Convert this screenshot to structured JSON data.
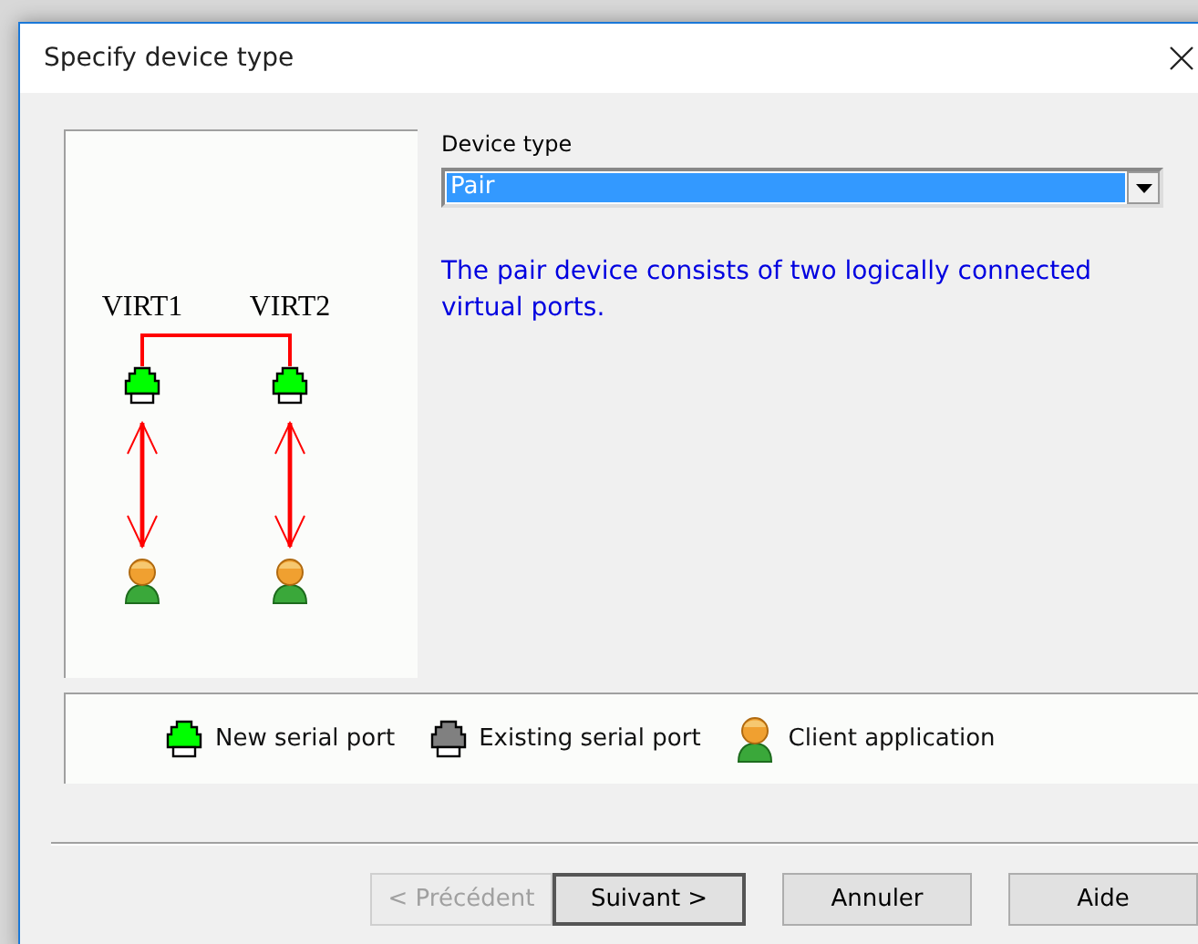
{
  "window": {
    "title": "Specify device type"
  },
  "device_type": {
    "label": "Device type",
    "value": "Pair"
  },
  "description": "The pair device consists of two logically connected virtual ports.",
  "diagram": {
    "ports": [
      {
        "label": "VIRT1",
        "kind": "new_port"
      },
      {
        "label": "VIRT2",
        "kind": "new_port"
      }
    ]
  },
  "legend": [
    {
      "kind": "new_port",
      "label": "New serial port"
    },
    {
      "kind": "existing_port",
      "label": "Existing serial port"
    },
    {
      "kind": "client",
      "label": "Client application"
    }
  ],
  "buttons": [
    {
      "label": "< Précédent",
      "disabled": true,
      "default": false
    },
    {
      "label": "Suivant >",
      "disabled": false,
      "default": true
    },
    {
      "label": "Annuler",
      "disabled": false,
      "default": false
    },
    {
      "label": "Aide",
      "disabled": false,
      "default": false
    }
  ]
}
